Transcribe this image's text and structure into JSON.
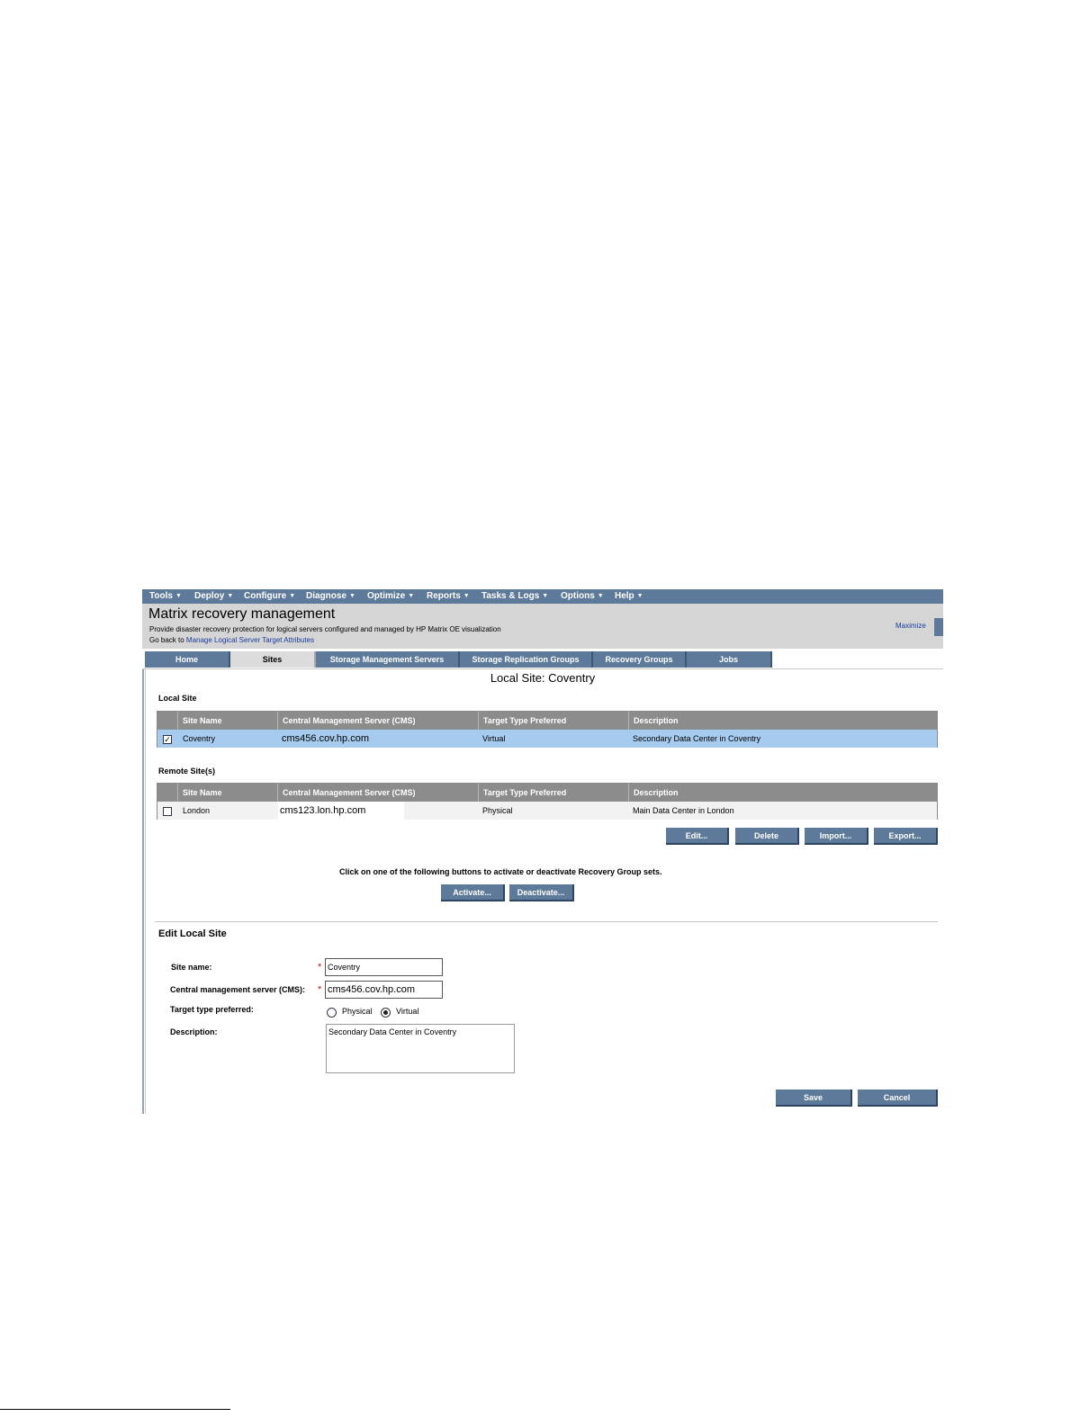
{
  "menubar": {
    "items": [
      "Tools",
      "Deploy",
      "Configure",
      "Diagnose",
      "Optimize",
      "Reports",
      "Tasks & Logs",
      "Options",
      "Help"
    ]
  },
  "header": {
    "title": "Matrix recovery management",
    "subtitle": "Provide disaster recovery protection for logical servers configured and managed by HP Matrix OE visualization",
    "goback_prefix": "Go back to",
    "goback_link": "Manage Logical Server Target Attributes",
    "maximize": "Maximize"
  },
  "tabs": [
    "Home",
    "Sites",
    "Storage Management Servers",
    "Storage Replication Groups",
    "Recovery Groups",
    "Jobs"
  ],
  "active_tab": "Sites",
  "section_heading": "Local Site: Coventry",
  "columns": [
    "Site Name",
    "Central Management Server (CMS)",
    "Target Type Preferred",
    "Description"
  ],
  "local_site": {
    "label": "Local Site",
    "rows": [
      {
        "checked": true,
        "site_name": "Coventry",
        "cms": "cms456.cov.hp.com",
        "target_type": "Virtual",
        "description": "Secondary Data Center in Coventry"
      }
    ]
  },
  "remote_sites": {
    "label": "Remote Site(s)",
    "rows": [
      {
        "checked": false,
        "site_name": "London",
        "cms": "cms123.lon.hp.com",
        "target_type": "Physical",
        "description": "Main Data Center in London"
      }
    ]
  },
  "table_buttons": {
    "edit": "Edit...",
    "delete": "Delete",
    "import": "Import...",
    "export": "Export..."
  },
  "activation": {
    "instruction": "Click on one of the following buttons to activate or deactivate Recovery Group sets.",
    "activate": "Activate...",
    "deactivate": "Deactivate..."
  },
  "edit_form": {
    "heading": "Edit Local Site",
    "site_name_label": "Site name:",
    "site_name_value": "Coventry",
    "cms_label": "Central management server (CMS):",
    "cms_value": "cms456.cov.hp.com",
    "target_type_label": "Target type preferred:",
    "target_options": [
      "Physical",
      "Virtual"
    ],
    "target_selected": "Virtual",
    "description_label": "Description:",
    "description_value": "Secondary Data Center in Coventry",
    "save": "Save",
    "cancel": "Cancel"
  },
  "colors": {
    "menubar": "#5d7a9b",
    "header_bg": "#d5d5d5",
    "selected_row": "#a6cbef",
    "table_header": "#8c8c8c",
    "required": "#d01010"
  }
}
